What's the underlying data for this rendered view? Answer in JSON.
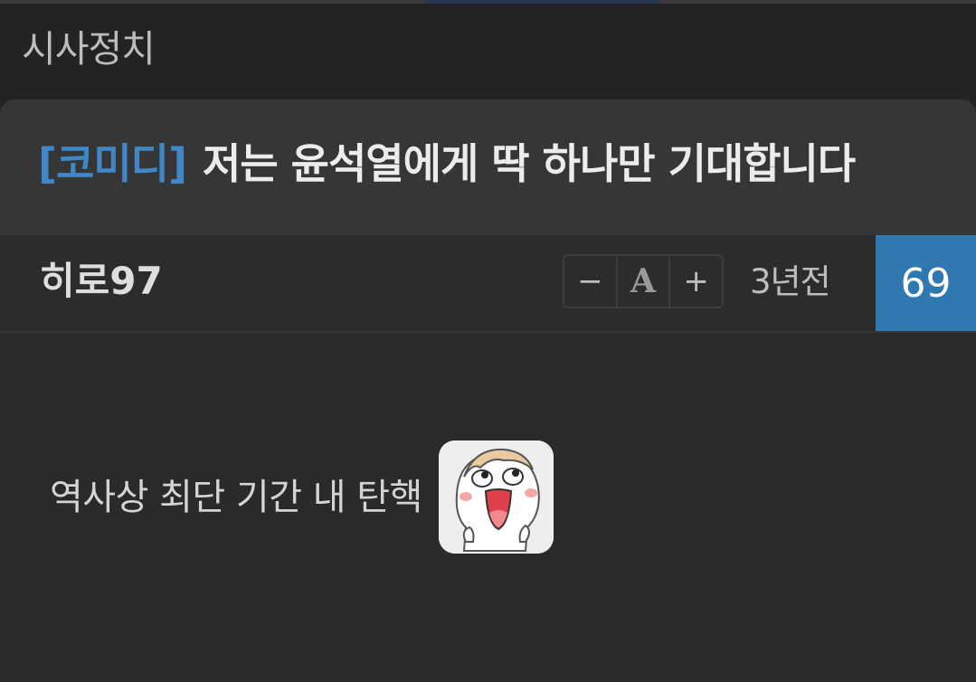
{
  "category": {
    "title": "시사정치"
  },
  "post": {
    "tag": "[코미디]",
    "title": "저는 윤석열에게 딱 하나만 기대합니다",
    "author": "히로97",
    "time_ago": "3년전",
    "comment_count": "69",
    "body_text": "역사상 최단 기간 내 탄핵"
  },
  "font_controls": {
    "decrease_label": "−",
    "reset_label": "A",
    "increase_label": "+"
  },
  "icons": {
    "emoticon": "laughing-character-emoticon"
  },
  "colors": {
    "background": "#232323",
    "header": "#363636",
    "tag": "#3f87c6",
    "badge": "#2f78b0"
  }
}
